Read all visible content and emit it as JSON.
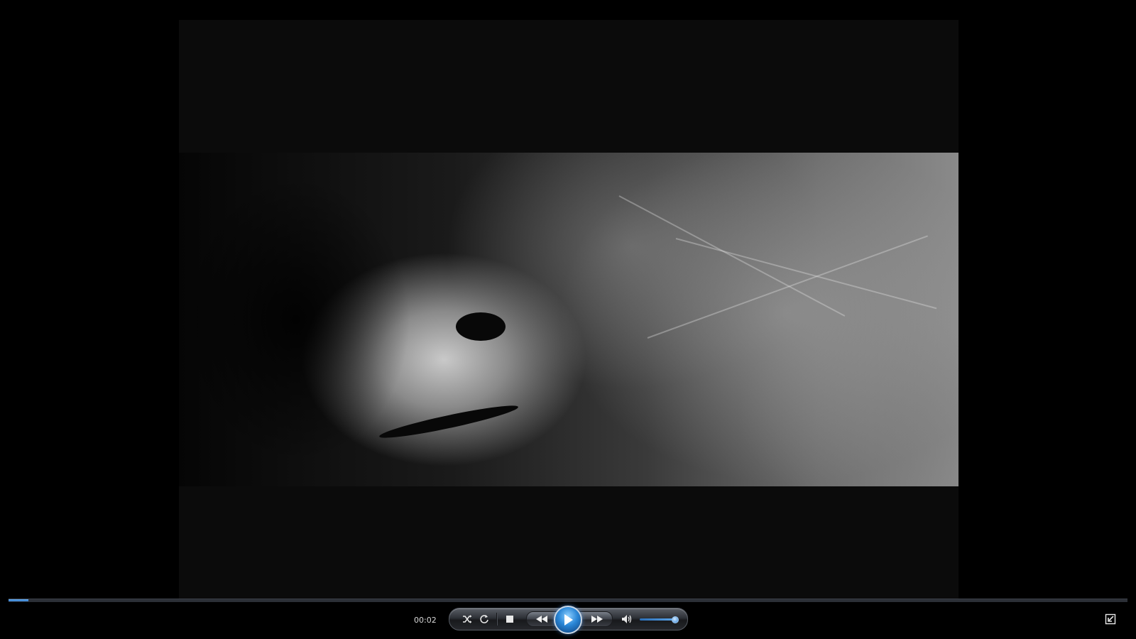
{
  "player": {
    "current_time": "00:02",
    "progress_fraction": 0.018,
    "volume_fraction": 0.9
  },
  "controls": {
    "shuffle_icon": "shuffle-icon",
    "repeat_icon": "repeat-icon",
    "stop_icon": "stop-icon",
    "previous_icon": "rewind-icon",
    "play_icon": "play-icon",
    "next_icon": "fast-forward-icon",
    "mute_icon": "speaker-icon",
    "fullscreen_icon": "exit-fullscreen-icon"
  },
  "colors": {
    "accent": "#2f78c8",
    "accent_light": "#6aaef0",
    "background": "#000000"
  }
}
